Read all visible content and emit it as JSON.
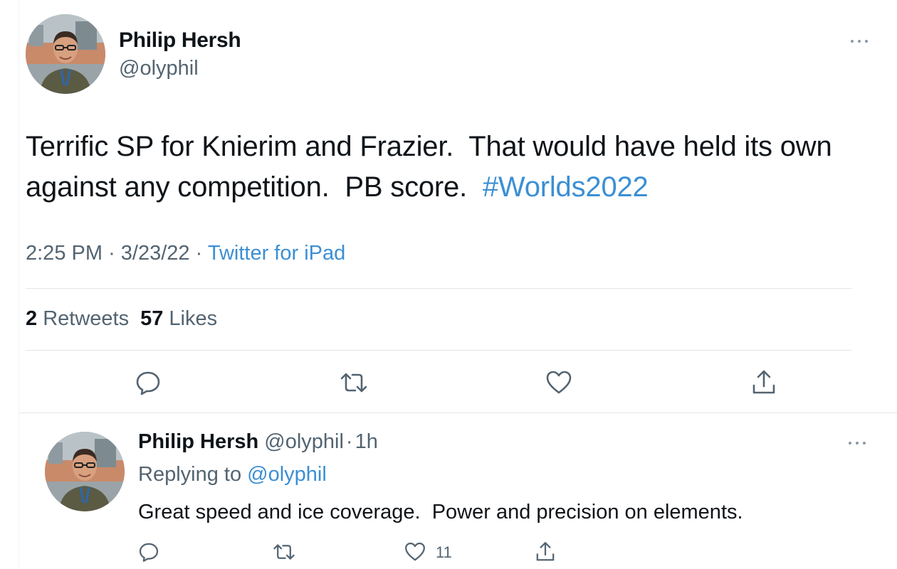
{
  "main_tweet": {
    "author_name": "Philip Hersh",
    "author_handle": "@olyphil",
    "text": "Terrific SP for Knierim and Frazier.  That would have held its own against any competition.  PB score.  ",
    "hashtag": "#Worlds2022",
    "time": "2:25 PM",
    "date": "3/23/22",
    "separator": "·",
    "source": "Twitter for iPad",
    "retweet_count": "2",
    "retweet_label": "Retweets",
    "like_count": "57",
    "like_label": "Likes"
  },
  "reply_tweet": {
    "author_name": "Philip Hersh",
    "author_handle": "@olyphil",
    "separator": "·",
    "time_ago": "1h",
    "replying_label": "Replying to",
    "replying_to": "@olyphil",
    "text": "Great speed and ice coverage.  Power and precision on elements.",
    "like_count": "11"
  },
  "icons": {
    "avatar": "avatar-photo",
    "more": "more-dots-icon",
    "reply": "reply-icon",
    "retweet": "retweet-icon",
    "like": "heart-icon",
    "share": "share-icon"
  },
  "colors": {
    "link": "#3b8fd4",
    "secondary_text": "#536471",
    "primary_text": "#0f1419",
    "divider": "#e1e6e9"
  }
}
